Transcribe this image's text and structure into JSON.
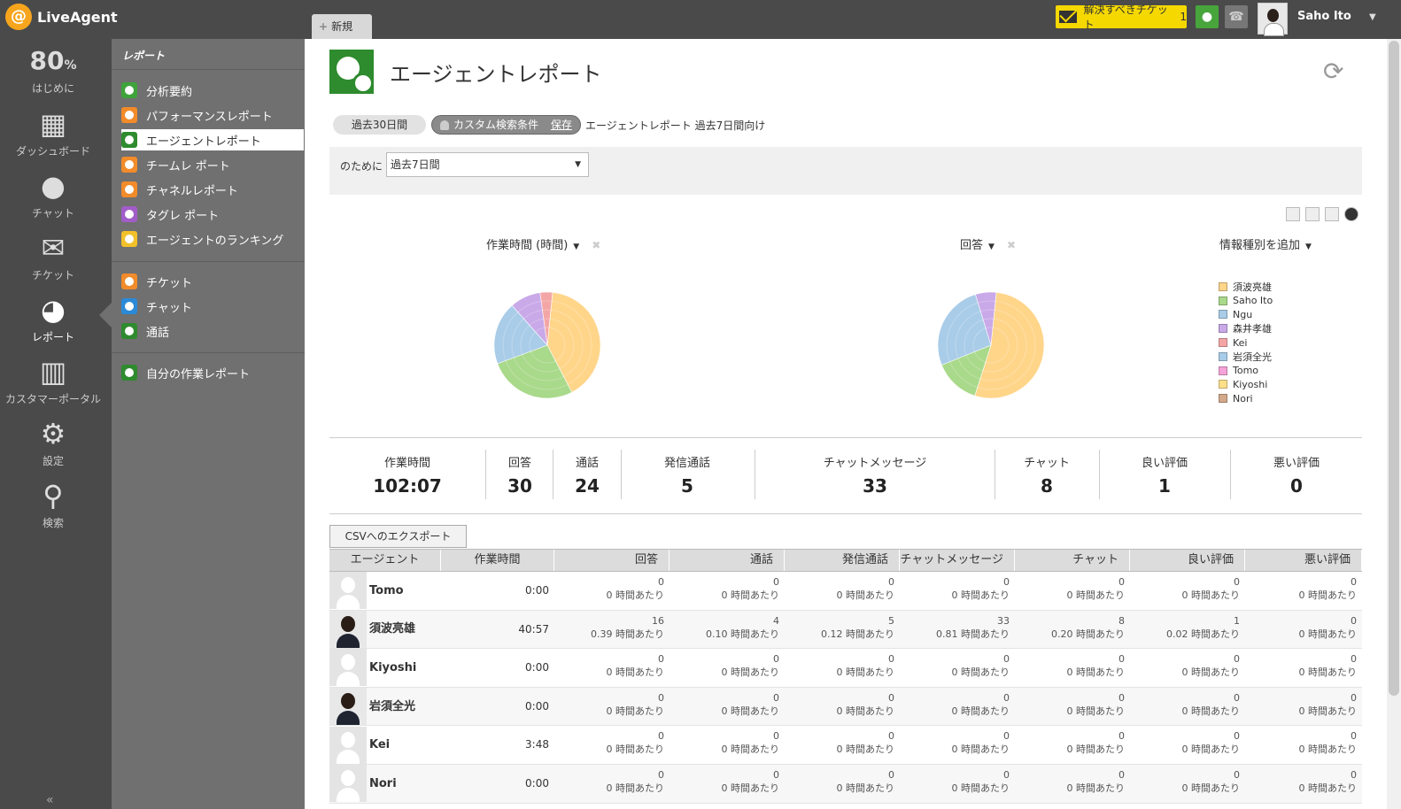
{
  "app": {
    "name": "LiveAgent",
    "new_tab": "新規"
  },
  "topbar": {
    "ticket_button": "解決すべきチケット",
    "ticket_count": "1",
    "user_name": "Saho Ito"
  },
  "leftnav": {
    "progress_value": "80",
    "progress_unit": "%",
    "items": [
      {
        "label": "はじめに"
      },
      {
        "label": "ダッシュボード"
      },
      {
        "label": "チャット"
      },
      {
        "label": "チケット"
      },
      {
        "label": "レポート"
      },
      {
        "label": "カスタマーポータル"
      },
      {
        "label": "設定"
      },
      {
        "label": "検索"
      }
    ]
  },
  "subnav": {
    "title": "レポート",
    "items": [
      {
        "label": "分析要約"
      },
      {
        "label": "パフォーマンスレポート"
      },
      {
        "label": "エージェントレポート"
      },
      {
        "label": "チームレ ポート"
      },
      {
        "label": "チャネルレポート"
      },
      {
        "label": "タグレ ポート"
      },
      {
        "label": "エージェントのランキング"
      },
      {
        "label": "チケット"
      },
      {
        "label": "チャット"
      },
      {
        "label": "通話"
      },
      {
        "label": "自分の作業レポート"
      }
    ]
  },
  "page": {
    "title": "エージェントレポート",
    "filter_pill": "過去30日間",
    "custom_pill": "カスタム検索条件",
    "save_link": "保存",
    "filter_description": "エージェントレポート 過去7日間向け",
    "for_label": "のために",
    "period_value": "過去7日間"
  },
  "charts_header": {
    "left_metric": "作業時間 (時間)",
    "right_metric": "回答",
    "add_info": "情報種別を追加"
  },
  "chart_data": [
    {
      "type": "pie",
      "title": "作業時間 (時間)",
      "categories": [
        "須波亮雄",
        "Saho Ito",
        "Ngu",
        "森井孝雄",
        "Kei",
        "岩須全光",
        "Tomo",
        "Kiyoshi",
        "Nori"
      ],
      "values": [
        40.95,
        27.1,
        19.2,
        9.4,
        3.8,
        0,
        0,
        0,
        0
      ],
      "colors": [
        "#ffd58a",
        "#a9d98a",
        "#a9cce8",
        "#c9a9e8",
        "#f4a6a6",
        "#a9cce8",
        "#f5a3d8",
        "#ffe08a",
        "#d2a98a"
      ]
    },
    {
      "type": "pie",
      "title": "回答",
      "categories": [
        "須波亮雄",
        "Saho Ito",
        "Ngu",
        "森井孝雄",
        "Kei",
        "岩須全光",
        "Tomo",
        "Kiyoshi",
        "Nori"
      ],
      "values": [
        16,
        4.2,
        7.9,
        1.9,
        0,
        0,
        0,
        0,
        0
      ],
      "colors": [
        "#ffd58a",
        "#a9d98a",
        "#a9cce8",
        "#c9a9e8",
        "#f4a6a6",
        "#a9cce8",
        "#f5a3d8",
        "#ffe08a",
        "#d2a98a"
      ]
    }
  ],
  "legend": [
    {
      "name": "須波亮雄",
      "color": "#ffd58a"
    },
    {
      "name": "Saho Ito",
      "color": "#a9d98a"
    },
    {
      "name": "Ngu",
      "color": "#a9cce8"
    },
    {
      "name": "森井孝雄",
      "color": "#c9a9e8"
    },
    {
      "name": "Kei",
      "color": "#f4a6a6"
    },
    {
      "name": "岩須全光",
      "color": "#a9cce8"
    },
    {
      "name": "Tomo",
      "color": "#f5a3d8"
    },
    {
      "name": "Kiyoshi",
      "color": "#ffe08a"
    },
    {
      "name": "Nori",
      "color": "#d2a98a"
    }
  ],
  "stats": [
    {
      "label": "作業時間",
      "value": "102:07"
    },
    {
      "label": "回答",
      "value": "30"
    },
    {
      "label": "通話",
      "value": "24"
    },
    {
      "label": "発信通話",
      "value": "5"
    },
    {
      "label": "チャットメッセージ",
      "value": "33"
    },
    {
      "label": "チャット",
      "value": "8"
    },
    {
      "label": "良い評価",
      "value": "1"
    },
    {
      "label": "悪い評価",
      "value": "0"
    }
  ],
  "csv_button": "CSVへのエクスポート",
  "table": {
    "columns": [
      "エージェント",
      "作業時間",
      "回答",
      "通話",
      "発信通話",
      "チャットメッセージ",
      "チャット",
      "良い評価",
      "悪い評価"
    ],
    "rows": [
      {
        "name": "Tomo",
        "time": "0:00",
        "photo": false,
        "cells": [
          [
            "0",
            "0 時間あたり"
          ],
          [
            "0",
            "0 時間あたり"
          ],
          [
            "0",
            "0 時間あたり"
          ],
          [
            "0",
            "0 時間あたり"
          ],
          [
            "0",
            "0 時間あたり"
          ],
          [
            "0",
            "0 時間あたり"
          ],
          [
            "0",
            "0 時間あたり"
          ]
        ]
      },
      {
        "name": "須波亮雄",
        "time": "40:57",
        "photo": true,
        "cells": [
          [
            "16",
            "0.39 時間あたり"
          ],
          [
            "4",
            "0.10 時間あたり"
          ],
          [
            "5",
            "0.12 時間あたり"
          ],
          [
            "33",
            "0.81 時間あたり"
          ],
          [
            "8",
            "0.20 時間あたり"
          ],
          [
            "1",
            "0.02 時間あたり"
          ],
          [
            "0",
            "0 時間あたり"
          ]
        ]
      },
      {
        "name": "Kiyoshi",
        "time": "0:00",
        "photo": false,
        "cells": [
          [
            "0",
            "0 時間あたり"
          ],
          [
            "0",
            "0 時間あたり"
          ],
          [
            "0",
            "0 時間あたり"
          ],
          [
            "0",
            "0 時間あたり"
          ],
          [
            "0",
            "0 時間あたり"
          ],
          [
            "0",
            "0 時間あたり"
          ],
          [
            "0",
            "0 時間あたり"
          ]
        ]
      },
      {
        "name": "岩須全光",
        "time": "0:00",
        "photo": true,
        "cells": [
          [
            "0",
            "0 時間あたり"
          ],
          [
            "0",
            "0 時間あたり"
          ],
          [
            "0",
            "0 時間あたり"
          ],
          [
            "0",
            "0 時間あたり"
          ],
          [
            "0",
            "0 時間あたり"
          ],
          [
            "0",
            "0 時間あたり"
          ],
          [
            "0",
            "0 時間あたり"
          ]
        ]
      },
      {
        "name": "Kei",
        "time": "3:48",
        "photo": false,
        "cells": [
          [
            "0",
            "0 時間あたり"
          ],
          [
            "0",
            "0 時間あたり"
          ],
          [
            "0",
            "0 時間あたり"
          ],
          [
            "0",
            "0 時間あたり"
          ],
          [
            "0",
            "0 時間あたり"
          ],
          [
            "0",
            "0 時間あたり"
          ],
          [
            "0",
            "0 時間あたり"
          ]
        ]
      },
      {
        "name": "Nori",
        "time": "0:00",
        "photo": false,
        "cells": [
          [
            "0",
            "0 時間あたり"
          ],
          [
            "0",
            "0 時間あたり"
          ],
          [
            "0",
            "0 時間あたり"
          ],
          [
            "0",
            "0 時間あたり"
          ],
          [
            "0",
            "0 時間あたり"
          ],
          [
            "0",
            "0 時間あたり"
          ],
          [
            "0",
            "0 時間あたり"
          ]
        ]
      }
    ]
  }
}
